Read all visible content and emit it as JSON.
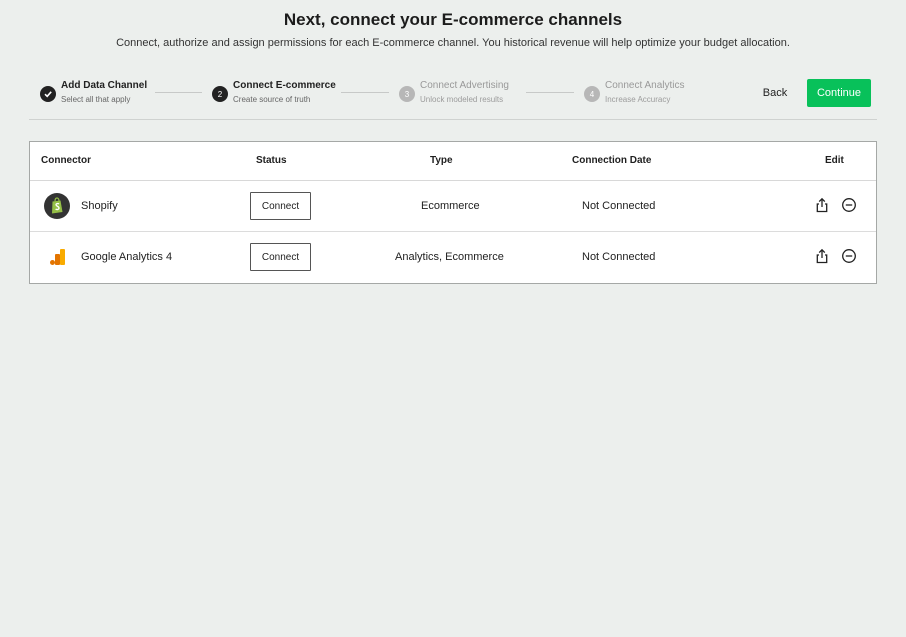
{
  "header": {
    "title": "Next, connect your E-commerce channels",
    "subtitle": "Connect, authorize and assign permissions for each E-commerce channel. You historical revenue will help optimize your budget allocation."
  },
  "stepper": {
    "steps": [
      {
        "number": "",
        "name": "Add Data Channel",
        "description": "Select all that apply",
        "state": "done"
      },
      {
        "number": "2",
        "name": "Connect E-commerce",
        "description": "Create source of truth",
        "state": "active"
      },
      {
        "number": "3",
        "name": "Connect Advertising",
        "description": "Unlock modeled results",
        "state": "pending"
      },
      {
        "number": "4",
        "name": "Connect Analytics",
        "description": "Increase Accuracy",
        "state": "pending"
      }
    ]
  },
  "actions": {
    "back_label": "Back",
    "continue_label": "Continue"
  },
  "table": {
    "headers": {
      "connector": "Connector",
      "status": "Status",
      "type": "Type",
      "connection_date": "Connection Date",
      "edit": "Edit"
    },
    "rows": [
      {
        "name": "Shopify",
        "icon": "shopify-logo",
        "status_button": "Connect",
        "type": "Ecommerce",
        "connection_date": "Not Connected"
      },
      {
        "name": "Google Analytics 4",
        "icon": "google-analytics-logo",
        "status_button": "Connect",
        "type": "Analytics, Ecommerce",
        "connection_date": "Not Connected"
      }
    ]
  },
  "colors": {
    "accent": "#08c15a",
    "background": "#ecefed"
  }
}
